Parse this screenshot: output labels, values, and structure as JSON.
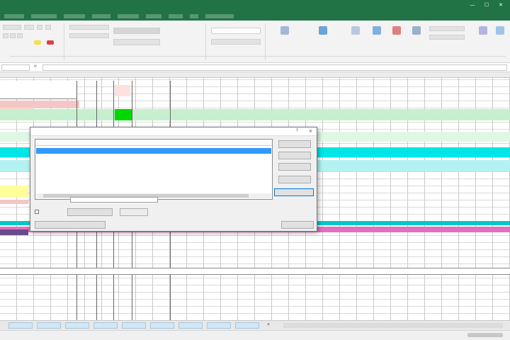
{
  "colors": {
    "excel_green": "#217346",
    "row_pink": "#f4c6c6",
    "row_green": "#c6efce",
    "cell_bright_green": "#00d800",
    "row_cyan": "#00e5e5",
    "row_light_cyan": "#b3f2f2",
    "row_yellow": "#ffff99",
    "row_magenta": "#e070c0",
    "selection_blue": "#3399ff"
  },
  "icons": {
    "close": "close-icon",
    "minimize": "minimize-icon",
    "maximize": "maximize-icon",
    "help": "help-icon",
    "add_sheet": "plus-icon"
  },
  "window": {
    "title": "",
    "minimize_glyph": "—",
    "maximize_glyph": "☐",
    "close_glyph": "✕"
  },
  "formula_bar": {
    "name_box": "",
    "fx_label": "fx",
    "content": ""
  },
  "grid": {
    "header_left": "",
    "section_header": ""
  },
  "dialog": {
    "title": "",
    "help_glyph": "?",
    "close_glyph": "✕",
    "columns": [
      "",
      "",
      "",
      ""
    ],
    "selected_row": [
      "",
      "",
      "",
      ""
    ]
  },
  "sheet_tabs": [
    "",
    "",
    "",
    "",
    "",
    "",
    "",
    "",
    ""
  ],
  "add_sheet_glyph": "+"
}
